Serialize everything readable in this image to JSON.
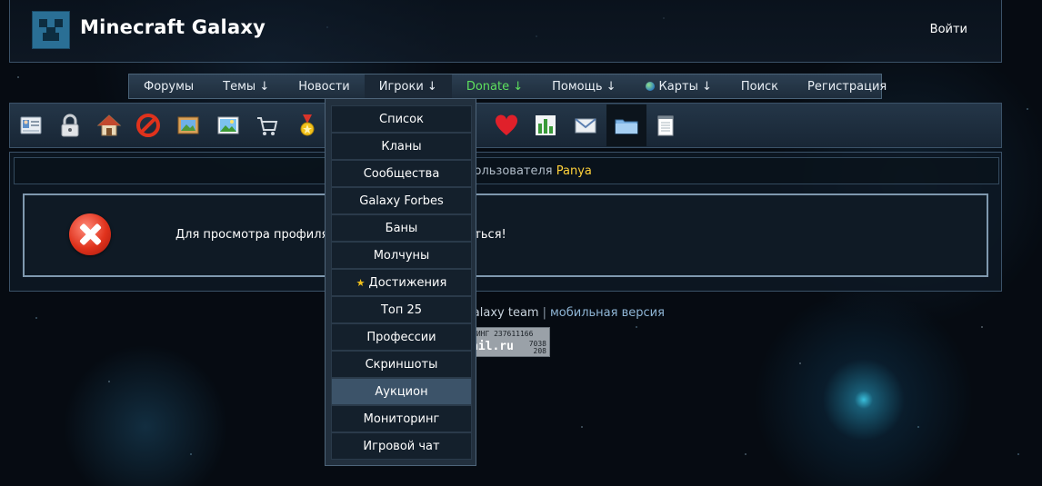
{
  "header": {
    "title": "Minecraft Galaxy",
    "login_label": "Войти"
  },
  "nav": {
    "items": [
      {
        "label": "Форумы"
      },
      {
        "label": "Темы ↓"
      },
      {
        "label": "Новости"
      },
      {
        "label": "Игроки ↓"
      },
      {
        "label": "Donate ↓"
      },
      {
        "label": "Помощь ↓"
      },
      {
        "label": "Карты ↓"
      },
      {
        "label": "Поиск"
      },
      {
        "label": "Регистрация"
      }
    ]
  },
  "toolbar": {
    "icons": [
      "profile-card-icon",
      "lock-icon",
      "home-icon",
      "block-icon",
      "picture-frame-icon",
      "landscape-image-icon",
      "shopping-cart-icon",
      "medal-icon",
      "heart-icon",
      "bar-chart-icon",
      "mail-icon",
      "folder-icon",
      "notepad-icon"
    ]
  },
  "content": {
    "subtitle_prefix": "пользователя",
    "subtitle_user": "Panya",
    "message_start": "Для просмотра профиля",
    "message_end": "аться!"
  },
  "footer": {
    "team_text": "aft galaxy team",
    "separator": "|",
    "mobile_link": "мобильная версия",
    "counter": {
      "top_text": "ТИНГ 237611166",
      "brand": "ail.ru",
      "n1": "7038",
      "n2": "208"
    }
  },
  "dropdown": {
    "items": [
      {
        "label": "Список"
      },
      {
        "label": "Кланы"
      },
      {
        "label": "Сообщества"
      },
      {
        "label": "Galaxy Forbes"
      },
      {
        "label": "Баны"
      },
      {
        "label": "Молчуны"
      },
      {
        "label": "Достижения"
      },
      {
        "label": "Топ 25"
      },
      {
        "label": "Профессии"
      },
      {
        "label": "Скриншоты"
      },
      {
        "label": "Аукцион"
      },
      {
        "label": "Мониторинг"
      },
      {
        "label": "Игровой чат"
      }
    ]
  },
  "colors": {
    "donate": "#5ee05e",
    "username": "#ffd23a",
    "mobile_link": "#8fb6d6",
    "dropdown_hover": "#3c5369"
  }
}
